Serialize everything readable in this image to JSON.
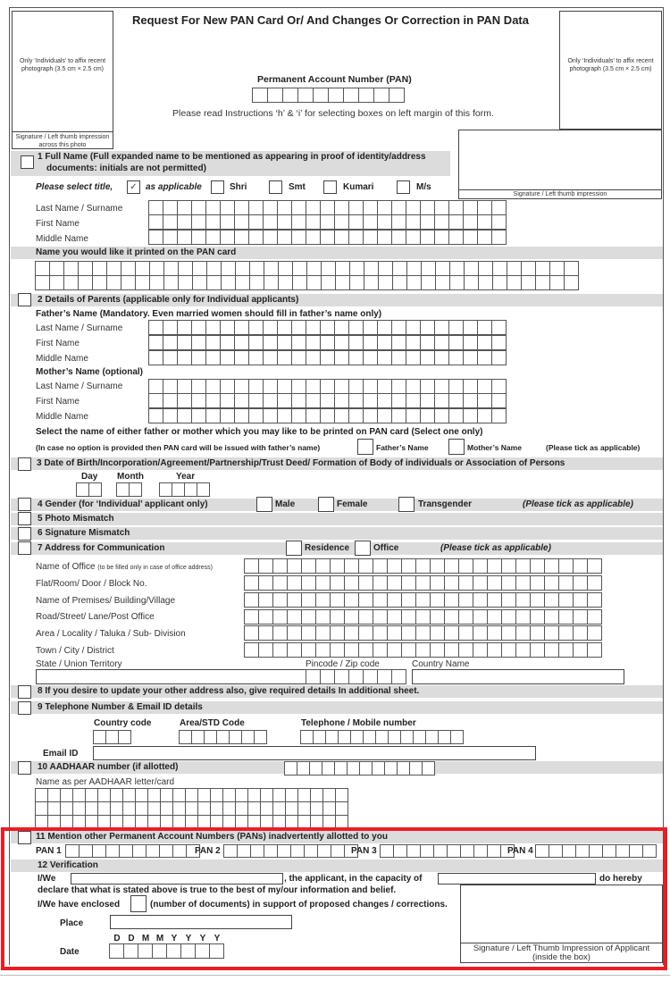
{
  "header": {
    "title": "Request For New PAN Card Or/ And Changes Or Correction in PAN Data",
    "pan_label": "Permanent Account Number (PAN)",
    "pan_cells": 10,
    "instruction": "Please read Instructions ‘h’ & ‘i’ for selecting boxes on left margin of this form.",
    "photo_left_text": "Only ‘Individuals’ to affix recent photograph (3.5 cm × 2.5 cm)",
    "photo_left_sig": "Signature / Left thumb impression across this photo",
    "photo_right_text": "Only ‘Individuals’ to affix recent photograph (3.5 cm × 2.5 cm)",
    "sig_box_label": "Signature / Left thumb impression"
  },
  "s1": {
    "heading_line1": "1 Full Name (Full expanded name to be mentioned as appearing in proof of identity/address",
    "heading_line2": "documents: initials are not permitted)",
    "title_prompt": "Please select title,",
    "tick_glyph": "✓",
    "as_applicable": "as applicable",
    "titles": [
      "Shri",
      "Smt",
      "Kumari",
      "M/s"
    ],
    "fields": [
      "Last Name / Surname",
      "First Name",
      "Middle Name"
    ],
    "printed_name_label": "Name you would like it printed on the PAN card"
  },
  "s2": {
    "heading": "2 Details of Parents (applicable only for Individual applicants)",
    "father_label": "Father’s Name (Mandatory. Even married women should fill in father’s name only)",
    "mother_label": "Mother’s Name (optional)",
    "fields": [
      "Last Name / Surname",
      "First Name",
      "Middle Name"
    ],
    "select_text": "Select the name of either father or mother which you may like to be printed on PAN card (Select one only)",
    "note": "(In case no option is provided then PAN card will be issued with father’s name)",
    "opt_father": "Father’s Name",
    "opt_mother": "Mother’s Name",
    "tick_note": "(Please tick as applicable)"
  },
  "s3": {
    "heading": "3 Date of Birth/Incorporation/Agreement/Partnership/Trust Deed/ Formation of Body of individuals or Association of Persons",
    "day": "Day",
    "month": "Month",
    "year": "Year"
  },
  "s4": {
    "heading": "4  Gender (for ‘Individual’ applicant only)",
    "options": [
      "Male",
      "Female",
      "Transgender"
    ],
    "tick_note": "(Please tick as applicable)"
  },
  "s5": {
    "heading": "5  Photo Mismatch"
  },
  "s6": {
    "heading": "6  Signature Mismatch"
  },
  "s7": {
    "heading": "7 Address for Communication",
    "opt_residence": "Residence",
    "opt_office": "Office",
    "tick_note": "(Please tick as applicable)",
    "office_label": "Name of Office",
    "office_note": "(to be filled only in case of office address)",
    "fields": [
      "Flat/Room/ Door / Block No.",
      "Name of Premises/ Building/Village",
      "Road/Street/ Lane/Post Office",
      "Area / Locality / Taluka / Sub- Division",
      "Town / City / District"
    ],
    "state_label": "State / Union Territory",
    "pincode_label": "Pincode / Zip code",
    "country_label": "Country Name"
  },
  "s8": {
    "heading": "8 If you desire to update your other address also, give required details In additional sheet."
  },
  "s9": {
    "heading": "9 Telephone Number & Email ID details",
    "country_code": "Country code",
    "area_code": "Area/STD Code",
    "phone": "Telephone / Mobile number",
    "email": "Email ID"
  },
  "s10": {
    "heading": "10 AADHAAR number (if allotted)",
    "name_label": "Name as per AADHAAR letter/card"
  },
  "s11": {
    "heading": "11 Mention other Permanent Account Numbers (PANs) inadvertently allotted to you",
    "pans": [
      "PAN 1",
      "PAN 2",
      "PAN 3",
      "PAN 4"
    ]
  },
  "s12": {
    "heading": "12 Verification",
    "iwe": "I/We",
    "applicant_text": ", the applicant, in the capacity of",
    "do_hereby": "do  hereby",
    "declare": "declare that what is stated above is true to the best of my/our information and belief.",
    "enclosed": "I/We have enclosed",
    "enclosed_rest": "(number of documents) in support of proposed changes / corrections.",
    "place": "Place",
    "date": "Date",
    "date_letters": [
      "D",
      "D",
      "M",
      "M",
      "Y",
      "Y",
      "Y",
      "Y"
    ],
    "sig_label": "Signature / Left Thumb Impression of Applicant (inside the box)"
  },
  "colors": {
    "band": "#dcdcdc",
    "highlight": "#ed1c24"
  }
}
